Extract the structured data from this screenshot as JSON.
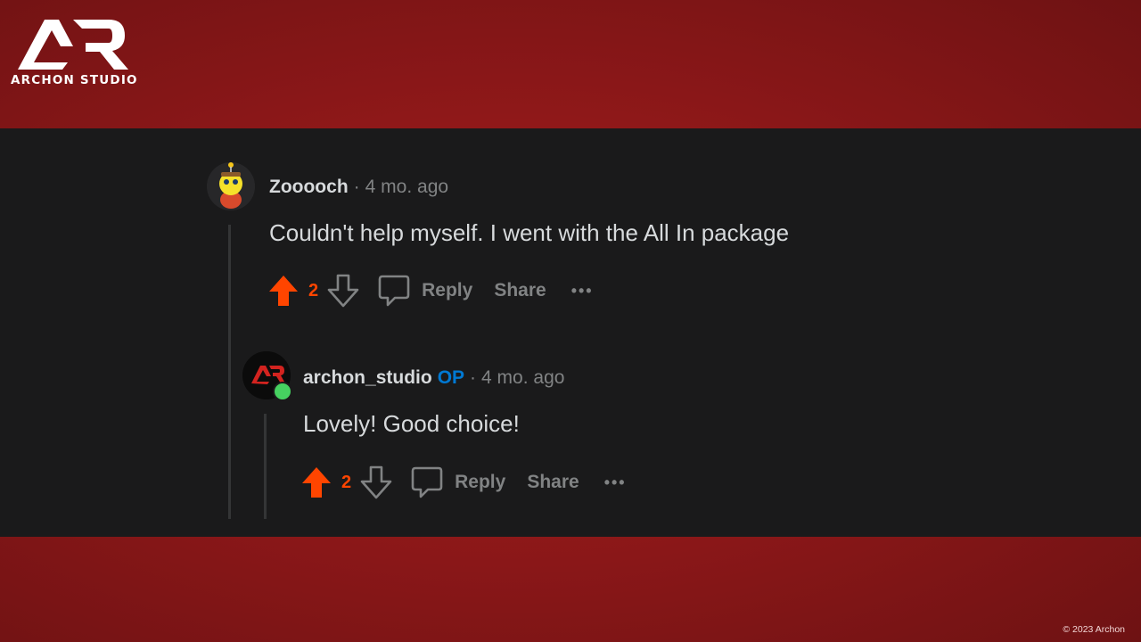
{
  "brand": {
    "name": "ARCHON STUDIO",
    "copyright": "© 2023 Archon"
  },
  "comments": [
    {
      "username": "Zooooch",
      "time": "4 mo. ago",
      "text": "Couldn't help myself. I went with the All In package",
      "votes": "2",
      "reply_label": "Reply",
      "share_label": "Share",
      "more_label": "•••"
    },
    {
      "username": "archon_studio",
      "op_badge": "OP",
      "time": "4 mo. ago",
      "text": "Lovely! Good choice!",
      "votes": "2",
      "reply_label": "Reply",
      "share_label": "Share",
      "more_label": "•••"
    }
  ],
  "colors": {
    "upvote": "#ff4500",
    "op": "#0079d3",
    "background": "#a81e1f",
    "panel": "#1a1a1b"
  }
}
